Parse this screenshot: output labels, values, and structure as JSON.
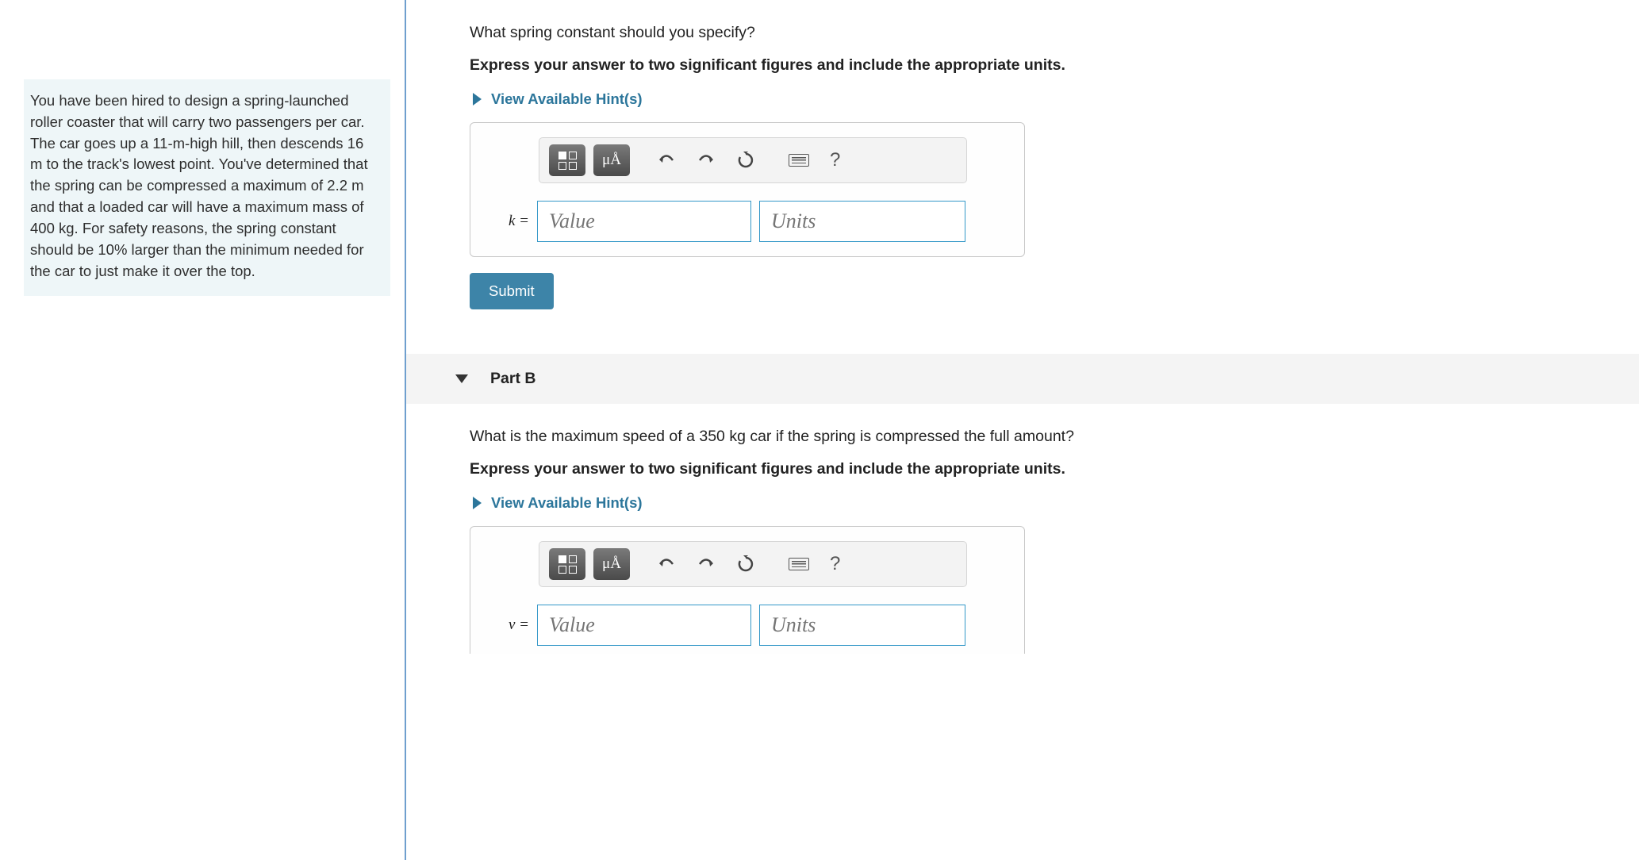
{
  "problem": {
    "text": "You have been hired to design a spring-launched roller coaster that will carry two passengers per car. The car goes up a 11-m-high hill, then descends 16 m to the track's lowest point. You've determined that the spring can be compressed a maximum of 2.2 m and that a loaded car will have a maximum mass of 400 kg. For safety reasons, the spring constant should be 10% larger than the minimum needed for the car to just make it over the top."
  },
  "partA": {
    "question": "What spring constant should you specify?",
    "instruction": "Express your answer to two significant figures and include the appropriate units.",
    "hints_label": "View Available Hint(s)",
    "var_label": "k =",
    "value_placeholder": "Value",
    "units_placeholder": "Units",
    "submit_label": "Submit",
    "toolbar": {
      "symbols": "μÅ",
      "help": "?"
    }
  },
  "partB": {
    "header": "Part B",
    "question": "What is the maximum speed of a 350 kg car if the spring is compressed the full amount?",
    "instruction": "Express your answer to two significant figures and include the appropriate units.",
    "hints_label": "View Available Hint(s)",
    "var_label": "v =",
    "value_placeholder": "Value",
    "units_placeholder": "Units",
    "toolbar": {
      "symbols": "μÅ",
      "help": "?"
    }
  }
}
